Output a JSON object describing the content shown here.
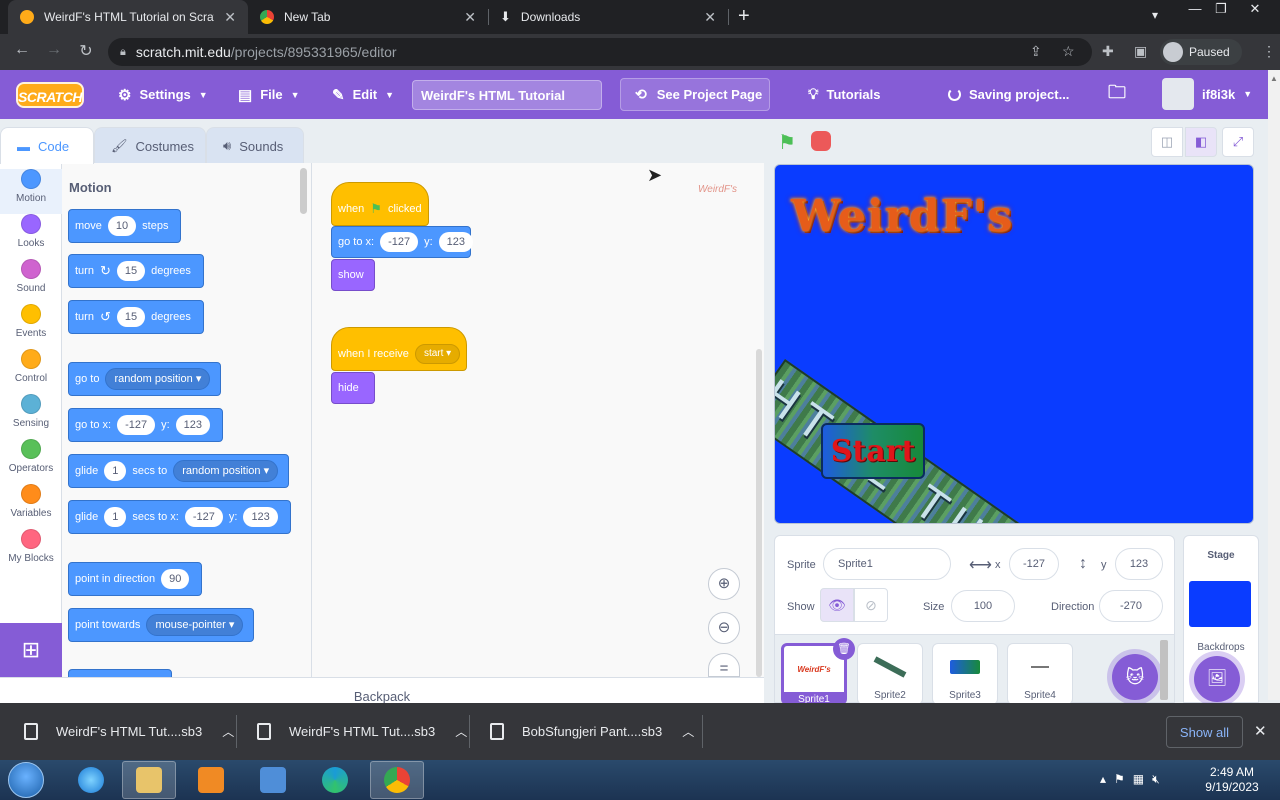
{
  "browser": {
    "tabs": [
      {
        "title": "WeirdF's HTML Tutorial on Scratch",
        "icon": "scratch-favicon-icon"
      },
      {
        "title": "New Tab",
        "icon": "chrome-icon"
      },
      {
        "title": "Downloads",
        "icon": "download-icon"
      }
    ],
    "url_host": "scratch.mit.edu",
    "url_path": "/projects/895331965/editor",
    "profile_status": "Paused"
  },
  "menubar": {
    "logo": "SCRATCH",
    "settings": "Settings",
    "file": "File",
    "edit": "Edit",
    "project_title": "WeirdF's HTML Tutorial",
    "see_project_page": "See Project Page",
    "tutorials": "Tutorials",
    "saving": "Saving project...",
    "username": "if8i3k"
  },
  "editor_tabs": [
    {
      "label": "Code",
      "icon": "code-icon"
    },
    {
      "label": "Costumes",
      "icon": "brush-icon"
    },
    {
      "label": "Sounds",
      "icon": "speaker-icon"
    }
  ],
  "categories": [
    {
      "label": "Motion",
      "color": "#4c97ff"
    },
    {
      "label": "Looks",
      "color": "#9966ff"
    },
    {
      "label": "Sound",
      "color": "#cf63cf"
    },
    {
      "label": "Events",
      "color": "#ffbf00"
    },
    {
      "label": "Control",
      "color": "#ffab19"
    },
    {
      "label": "Sensing",
      "color": "#5cb1d6"
    },
    {
      "label": "Operators",
      "color": "#59c059"
    },
    {
      "label": "Variables",
      "color": "#ff8c1a"
    },
    {
      "label": "My Blocks",
      "color": "#ff6680"
    }
  ],
  "palette": {
    "heading": "Motion",
    "move": {
      "a": "move",
      "v": "10",
      "b": "steps"
    },
    "turn_right": {
      "a": "turn",
      "v": "15",
      "b": "degrees"
    },
    "turn_left": {
      "a": "turn",
      "v": "15",
      "b": "degrees"
    },
    "goto": {
      "a": "go to",
      "d": "random position"
    },
    "gotoxy": {
      "a": "go to x:",
      "x": "-127",
      "b": "y:",
      "y": "123"
    },
    "glide_to": {
      "a": "glide",
      "v": "1",
      "b": "secs to",
      "d": "random position"
    },
    "glide_xy": {
      "a": "glide",
      "v": "1",
      "b": "secs to x:",
      "x": "-127",
      "c": "y:",
      "y": "123"
    },
    "point_dir": {
      "a": "point in direction",
      "v": "90"
    },
    "point_towards": {
      "a": "point towards",
      "d": "mouse-pointer"
    }
  },
  "scripts": {
    "watermark": "WeirdF's",
    "s1_hat": {
      "a": "when",
      "b": "clicked"
    },
    "s1_goto": {
      "a": "go to x:",
      "x": "-127",
      "b": "y:",
      "y": "123"
    },
    "s1_show": "show",
    "s2_hat": {
      "a": "when I receive",
      "d": "start"
    },
    "s2_hide": "hide"
  },
  "backpack": "Backpack",
  "stage": {
    "title_art": "WeirdF's",
    "banner_text": "HTML TUTORIAL!",
    "start_button": "Start"
  },
  "sprite_info": {
    "sprite_label": "Sprite",
    "sprite_name": "Sprite1",
    "x_label": "x",
    "x": "-127",
    "y_label": "y",
    "y": "123",
    "show_label": "Show",
    "size_label": "Size",
    "size": "100",
    "direction_label": "Direction",
    "direction": "-270"
  },
  "sprites": [
    {
      "name": "Sprite1",
      "thumb": "WeirdF's"
    },
    {
      "name": "Sprite2",
      "thumb": ""
    },
    {
      "name": "Sprite3",
      "thumb": ""
    },
    {
      "name": "Sprite4",
      "thumb": ""
    }
  ],
  "stage_target": {
    "label": "Stage",
    "backdrops": "Backdrops"
  },
  "downloads": [
    {
      "name": "WeirdF's HTML Tut....sb3"
    },
    {
      "name": "WeirdF's HTML Tut....sb3"
    },
    {
      "name": "BobSfungjeri Pant....sb3"
    }
  ],
  "show_all": "Show all",
  "taskbar": {
    "time": "2:49 AM",
    "date": "9/19/2023"
  }
}
